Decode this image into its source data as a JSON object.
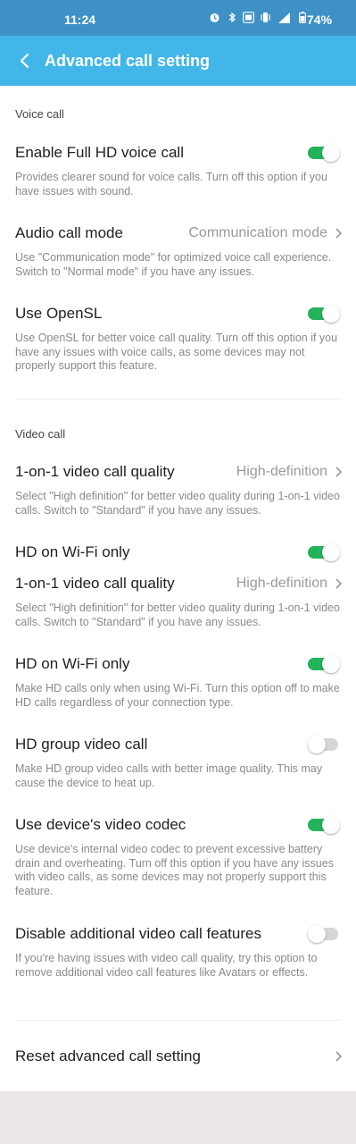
{
  "status_bar": {
    "time": "11:24",
    "battery": "74%",
    "icons": [
      "alarm-icon",
      "bluetooth-icon",
      "volte-icon",
      "vibrate-icon",
      "signal-4g-icon",
      "battery-icon"
    ]
  },
  "app_bar": {
    "title": "Advanced call setting",
    "colors": {
      "status": "#3d91c6",
      "bar": "#42b6e9"
    }
  },
  "voice_section": {
    "header": "Voice call",
    "full_hd": {
      "label": "Enable Full HD voice call",
      "desc": "Provides clearer sound for voice calls. Turn off this option if you have issues with sound.",
      "on": true
    },
    "audio_mode": {
      "label": "Audio call mode",
      "value": "Communication mode",
      "desc": "Use \"Communication mode\" for optimized voice call experience. Switch to \"Normal mode\" if you have any issues."
    },
    "opensl": {
      "label": "Use OpenSL",
      "desc": "Use OpenSL for better voice call quality. Turn off this option if you have any issues with voice calls, as some devices may not properly support this feature.",
      "on": true
    }
  },
  "video_section": {
    "header": "Video call",
    "quality_1": {
      "label": "1-on-1 video call quality",
      "value": "High-definition",
      "desc": "Select \"High definition\" for better video quality during 1-on-1 video calls. Switch to \"Standard\" if you have any issues."
    },
    "hd_wifi_1": {
      "label": "HD on Wi-Fi only",
      "on": true
    },
    "quality_2": {
      "label": "1-on-1 video call quality",
      "value": "High-definition",
      "desc": "Select \"High definition\" for better video quality during 1-on-1 video calls. Switch to \"Standard\" if you have any issues."
    },
    "hd_wifi_2": {
      "label": "HD on Wi-Fi only",
      "desc": "Make HD calls only when using Wi-Fi. Turn this option off to make HD calls regardless of your connection type.",
      "on": true
    },
    "hd_group": {
      "label": "HD group video call",
      "desc": "Make HD group video calls with better image quality. This may cause the device to heat up.",
      "on": false
    },
    "codec": {
      "label": "Use device's video codec",
      "desc": "Use device's internal video codec to prevent excessive battery drain and overheating. Turn off this option if you have any issues with video calls, as some devices may not properly support this feature.",
      "on": true
    },
    "disable_features": {
      "label": "Disable additional video call features",
      "desc": "If you're having issues with video call quality, try this option to remove additional video call features like Avatars or effects.",
      "on": false
    }
  },
  "reset": {
    "label": "Reset advanced call setting"
  }
}
